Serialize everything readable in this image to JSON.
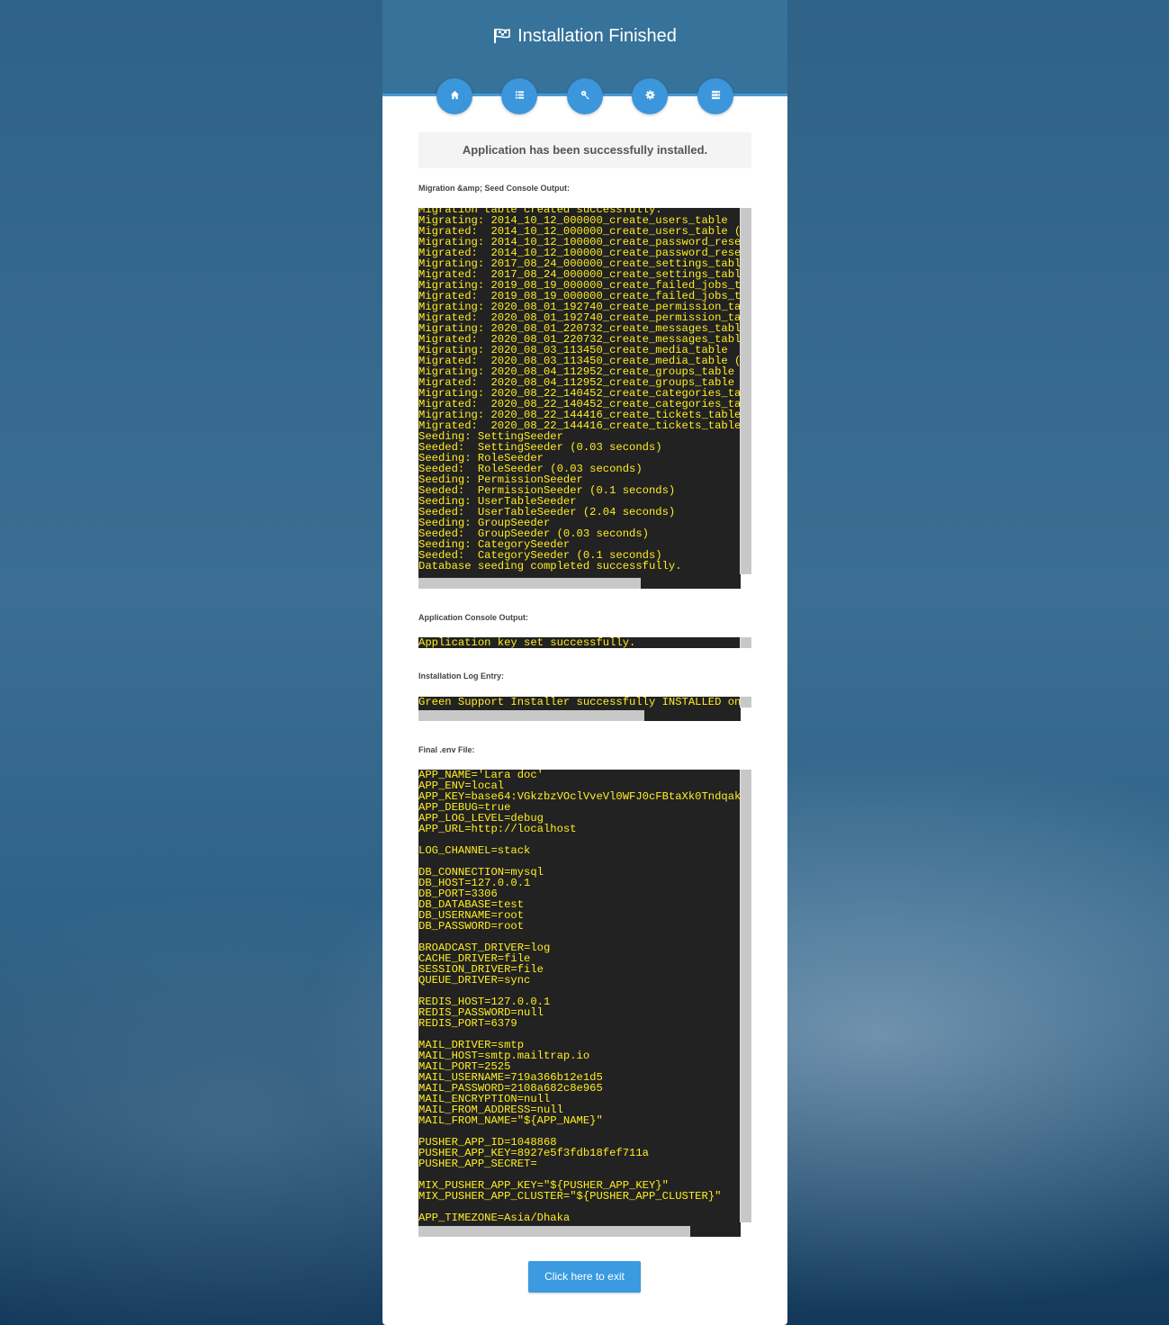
{
  "header": {
    "title": "Installation Finished"
  },
  "steps": [
    {
      "icon": "home-icon"
    },
    {
      "icon": "list-icon"
    },
    {
      "icon": "key-icon"
    },
    {
      "icon": "gear-icon"
    },
    {
      "icon": "server-icon"
    }
  ],
  "alert": "Application has been successfully installed.",
  "migration": {
    "label": "Migration &amp; Seed Console Output:",
    "output": "Migration table created successfully.\nMigrating: 2014_10_12_000000_create_users_table\nMigrated:  2014_10_12_000000_create_users_table (0\nMigrating: 2014_10_12_100000_create_password_reset\nMigrated:  2014_10_12_100000_create_password_reset\nMigrating: 2017_08_24_000000_create_settings_table\nMigrated:  2017_08_24_000000_create_settings_table\nMigrating: 2019_08_19_000000_create_failed_jobs_ta\nMigrated:  2019_08_19_000000_create_failed_jobs_ta\nMigrating: 2020_08_01_192740_create_permission_tab\nMigrated:  2020_08_01_192740_create_permission_tab\nMigrating: 2020_08_01_220732_create_messages_table\nMigrated:  2020_08_01_220732_create_messages_table\nMigrating: 2020_08_03_113450_create_media_table\nMigrated:  2020_08_03_113450_create_media_table (0\nMigrating: 2020_08_04_112952_create_groups_table\nMigrated:  2020_08_04_112952_create_groups_table (\nMigrating: 2020_08_22_140452_create_categories_tab\nMigrated:  2020_08_22_140452_create_categories_tab\nMigrating: 2020_08_22_144416_create_tickets_table\nMigrated:  2020_08_22_144416_create_tickets_table\nSeeding: SettingSeeder\nSeeded:  SettingSeeder (0.03 seconds)\nSeeding: RoleSeeder\nSeeded:  RoleSeeder (0.03 seconds)\nSeeding: PermissionSeeder\nSeeded:  PermissionSeeder (0.1 seconds)\nSeeding: UserTableSeeder\nSeeded:  UserTableSeeder (2.04 seconds)\nSeeding: GroupSeeder\nSeeded:  GroupSeeder (0.03 seconds)\nSeeding: CategorySeeder\nSeeded:  CategorySeeder (0.1 seconds)\nDatabase seeding completed successfully."
  },
  "app_console": {
    "label": "Application Console Output:",
    "output": "Application key set successfully."
  },
  "install_log": {
    "label": "Installation Log Entry:",
    "output": "Green Support Installer successfully INSTALLED on"
  },
  "env_file": {
    "label": "Final .env File:",
    "output": "APP_NAME='Lara doc'\nAPP_ENV=local\nAPP_KEY=base64:VGkzbzVOclVveVl0WFJ0cFBtaXk0TndqakN\nAPP_DEBUG=true\nAPP_LOG_LEVEL=debug\nAPP_URL=http://localhost\n\nLOG_CHANNEL=stack\n\nDB_CONNECTION=mysql\nDB_HOST=127.0.0.1\nDB_PORT=3306\nDB_DATABASE=test\nDB_USERNAME=root\nDB_PASSWORD=root\n\nBROADCAST_DRIVER=log\nCACHE_DRIVER=file\nSESSION_DRIVER=file\nQUEUE_DRIVER=sync\n\nREDIS_HOST=127.0.0.1\nREDIS_PASSWORD=null\nREDIS_PORT=6379\n\nMAIL_DRIVER=smtp\nMAIL_HOST=smtp.mailtrap.io\nMAIL_PORT=2525\nMAIL_USERNAME=719a366b12e1d5\nMAIL_PASSWORD=2108a682c8e965\nMAIL_ENCRYPTION=null\nMAIL_FROM_ADDRESS=null\nMAIL_FROM_NAME=\"${APP_NAME}\"\n\nPUSHER_APP_ID=1048868\nPUSHER_APP_KEY=8927e5f3fdb18fef711a\nPUSHER_APP_SECRET=\n\nMIX_PUSHER_APP_KEY=\"${PUSHER_APP_KEY}\"\nMIX_PUSHER_APP_CLUSTER=\"${PUSHER_APP_CLUSTER}\"\n\nAPP_TIMEZONE=Asia/Dhaka"
  },
  "exit_button": "Click here to exit",
  "colors": {
    "header_bg": "#36729a",
    "step_accent": "#3b96dc",
    "console_bg": "#222222",
    "console_text": "#ffee22",
    "button_bg": "#3b9ae0"
  }
}
